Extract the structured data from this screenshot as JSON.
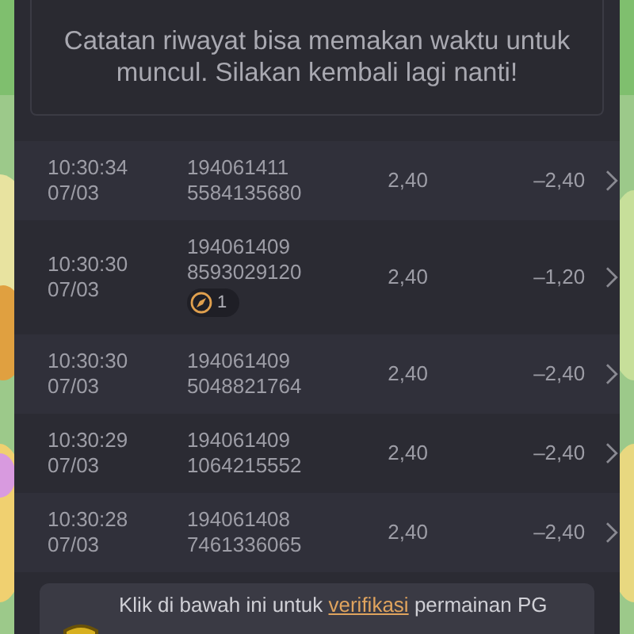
{
  "notice": {
    "text": "Catatan riwayat bisa memakan waktu untuk muncul. Silakan kembali lagi nanti!"
  },
  "history": [
    {
      "time": "10:30:34",
      "date": "07/03",
      "round_id": "194061411",
      "transaction_id": "5584135680",
      "bet": "2,40",
      "profit": "–2,40"
    },
    {
      "time": "10:30:30",
      "date": "07/03",
      "round_id": "194061409",
      "transaction_id": "8593029120",
      "bet": "2,40",
      "profit": "–1,20",
      "badge": "1"
    },
    {
      "time": "10:30:30",
      "date": "07/03",
      "round_id": "194061409",
      "transaction_id": "5048821764",
      "bet": "2,40",
      "profit": "–2,40"
    },
    {
      "time": "10:30:29",
      "date": "07/03",
      "round_id": "194061409",
      "transaction_id": "1064215552",
      "bet": "2,40",
      "profit": "–2,40"
    },
    {
      "time": "10:30:28",
      "date": "07/03",
      "round_id": "194061408",
      "transaction_id": "7461336065",
      "bet": "2,40",
      "profit": "–2,40"
    }
  ],
  "verify_notice": {
    "text_before": "Klik di bawah ini untuk ",
    "link": "verifikasi",
    "text_after": " permainan PG"
  }
}
